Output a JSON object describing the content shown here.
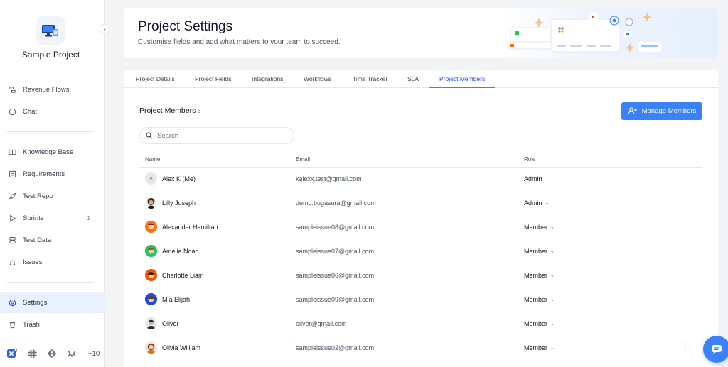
{
  "sidebar": {
    "project_name": "Sample Project",
    "items": [
      {
        "label": "Revenue Flows",
        "icon": "flow-icon"
      },
      {
        "label": "Chat",
        "icon": "chat-icon"
      },
      {
        "label": "Knowledge Base",
        "icon": "book-icon"
      },
      {
        "label": "Requirements",
        "icon": "requirements-icon"
      },
      {
        "label": "Test Repo",
        "icon": "rocket-icon"
      },
      {
        "label": "Sprints",
        "icon": "play-icon",
        "count": "1"
      },
      {
        "label": "Test Data",
        "icon": "database-icon"
      },
      {
        "label": "Issues",
        "icon": "bug-icon"
      },
      {
        "label": "Settings",
        "icon": "settings-icon",
        "active": true
      },
      {
        "label": "Trash",
        "icon": "trash-icon"
      }
    ],
    "integrations_more": "+10"
  },
  "header": {
    "title": "Project Settings",
    "subtitle": "Customise fields and add what matters to your team to succeed."
  },
  "tabs": [
    {
      "label": "Project Details"
    },
    {
      "label": "Project Fields"
    },
    {
      "label": "Integrations"
    },
    {
      "label": "Workflows"
    },
    {
      "label": "Time Tracker"
    },
    {
      "label": "SLA"
    },
    {
      "label": "Project Members",
      "active": true
    }
  ],
  "members": {
    "title": "Project Members",
    "count": "8",
    "manage_label": "Manage Members",
    "search_placeholder": "Search",
    "columns": {
      "name": "Name",
      "email": "Email",
      "role": "Role"
    },
    "rows": [
      {
        "name": "Alex K (Me)",
        "email": "kalexx.test@gmail.com",
        "role": "Admin",
        "initial": "A"
      },
      {
        "name": "Lilly Joseph",
        "email": "demo.bugasura@gmail.com",
        "role": "Admin"
      },
      {
        "name": "Alexander Hamiltan",
        "email": "sampleissue08@gmail.com",
        "role": "Member"
      },
      {
        "name": "Amelia Noah",
        "email": "sampleissue07@gmail.com",
        "role": "Member"
      },
      {
        "name": "Charlotte Liam",
        "email": "sampleissue06@gmail.com",
        "role": "Member"
      },
      {
        "name": "Mia Elijah",
        "email": "sampleissue09@gmail.com",
        "role": "Member"
      },
      {
        "name": "Oliver",
        "email": "oliver@gmail.com",
        "role": "Member"
      },
      {
        "name": "Olivia William",
        "email": "sampleissue02@gmail.com",
        "role": "Member"
      }
    ]
  },
  "colors": {
    "accent": "#3b82f6",
    "active_nav_bg": "#e8f1fd"
  }
}
